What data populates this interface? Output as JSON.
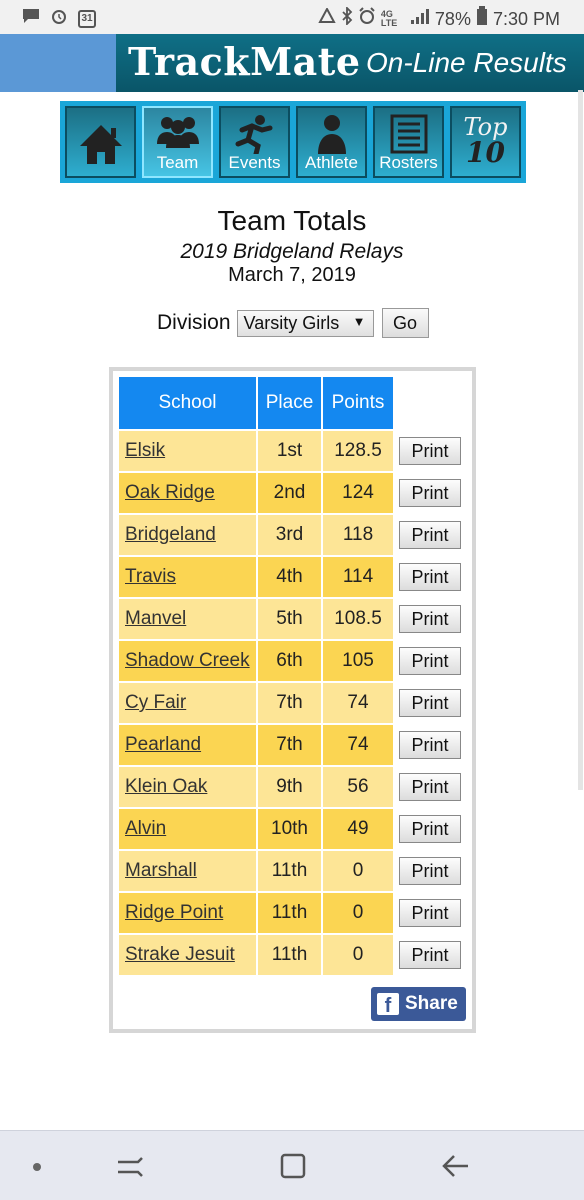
{
  "status_bar": {
    "battery": "78%",
    "time": "7:30 PM",
    "calendar_day": "31",
    "network": "4G LTE"
  },
  "header": {
    "brand": "TrackMate",
    "subtitle": "On-Line Results"
  },
  "nav": {
    "items": [
      {
        "label": "",
        "icon": "home-icon"
      },
      {
        "label": "Team",
        "icon": "team-icon"
      },
      {
        "label": "Events",
        "icon": "runner-icon"
      },
      {
        "label": "Athlete",
        "icon": "athlete-icon"
      },
      {
        "label": "Rosters",
        "icon": "roster-icon"
      },
      {
        "label": "Top 10",
        "top": "Top",
        "ten": "10"
      }
    ]
  },
  "page": {
    "title": "Team Totals",
    "meet": "2019 Bridgeland Relays",
    "date": "March 7, 2019"
  },
  "division": {
    "label": "Division",
    "selected": "Varsity Girls",
    "go_label": "Go"
  },
  "table": {
    "headers": {
      "school": "School",
      "place": "Place",
      "points": "Points"
    },
    "print_label": "Print",
    "rows": [
      {
        "school": "Elsik",
        "place": "1st",
        "points": "128.5"
      },
      {
        "school": "Oak Ridge",
        "place": "2nd",
        "points": "124"
      },
      {
        "school": "Bridgeland",
        "place": "3rd",
        "points": "118"
      },
      {
        "school": "Travis",
        "place": "4th",
        "points": "114"
      },
      {
        "school": "Manvel",
        "place": "5th",
        "points": "108.5"
      },
      {
        "school": "Shadow Creek",
        "place": "6th",
        "points": "105"
      },
      {
        "school": "Cy Fair",
        "place": "7th",
        "points": "74"
      },
      {
        "school": "Pearland",
        "place": "7th",
        "points": "74"
      },
      {
        "school": "Klein Oak",
        "place": "9th",
        "points": "56"
      },
      {
        "school": "Alvin",
        "place": "10th",
        "points": "49"
      },
      {
        "school": "Marshall",
        "place": "11th",
        "points": "0"
      },
      {
        "school": "Ridge Point",
        "place": "11th",
        "points": "0"
      },
      {
        "school": "Strake Jesuit",
        "place": "11th",
        "points": "0"
      }
    ]
  },
  "share": {
    "label": "Share",
    "fb": "f"
  },
  "colors": {
    "header_blue": "#1488f0",
    "row_light": "#fde596",
    "row_dark": "#fbd552",
    "nav_cyan": "#1aa6d8",
    "facebook": "#3b5998"
  }
}
